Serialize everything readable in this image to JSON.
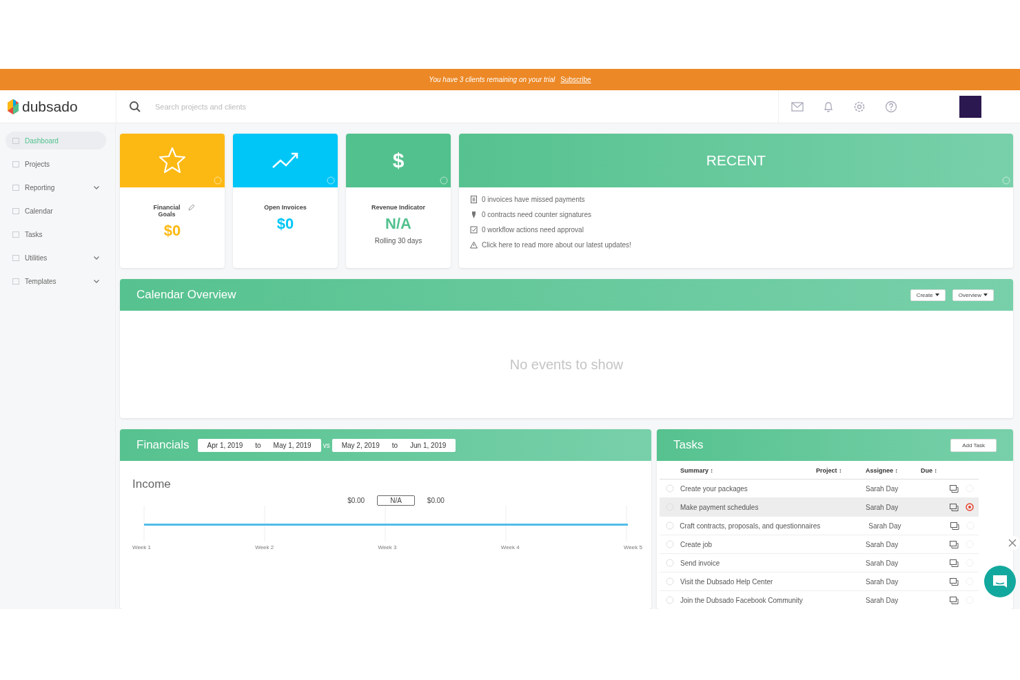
{
  "banner": {
    "text": "You have 3 clients remaining on your trial",
    "link": "Subscribe"
  },
  "header": {
    "logo": "dubsado",
    "search": {
      "placeholder": "Search projects and clients"
    }
  },
  "sidebar": {
    "items": [
      {
        "label": "Dashboard",
        "selected": true,
        "expandable": false
      },
      {
        "label": "Projects",
        "selected": false,
        "expandable": false
      },
      {
        "label": "Reporting",
        "selected": false,
        "expandable": true
      },
      {
        "label": "Calendar",
        "selected": false,
        "expandable": false
      },
      {
        "label": "Tasks",
        "selected": false,
        "expandable": false
      },
      {
        "label": "Utilities",
        "selected": false,
        "expandable": true
      },
      {
        "label": "Templates",
        "selected": false,
        "expandable": true
      }
    ]
  },
  "cards": [
    {
      "kind": "goal",
      "color": "#fdb913",
      "title": "Financial Goals",
      "value": "$0",
      "editable": true
    },
    {
      "kind": "trend",
      "color": "#00c6f7",
      "title": "Open Invoices",
      "value": "$0",
      "editable": false
    },
    {
      "kind": "dollar",
      "color": "#52c18e",
      "symbol": "$",
      "title": "Revenue Indicator",
      "value": "N/A",
      "note": "Rolling 30 days",
      "editable": false
    }
  ],
  "recent": {
    "title": "RECENT",
    "items": [
      {
        "kind": "invoice",
        "text": "0 invoices have missed payments"
      },
      {
        "kind": "contract",
        "text": "0 contracts need counter signatures"
      },
      {
        "kind": "workflow",
        "text": "0 workflow actions need approval"
      },
      {
        "kind": "alert",
        "text": "Click here to read more about our latest updates!"
      }
    ]
  },
  "calendar": {
    "title": "Calendar Overview",
    "buttons": [
      "Create",
      "Overview"
    ],
    "empty": "No events to show"
  },
  "financials": {
    "title": "Financials",
    "range_a": {
      "from": "Apr 1, 2019",
      "sep": "to",
      "to": "May 1, 2019"
    },
    "vs": "vs",
    "range_b": {
      "from": "May 2, 2019",
      "sep": "to",
      "to": "Jun 1, 2019"
    },
    "chart_title": "Income",
    "left_total": "$0.00",
    "change": "N/A",
    "right_total": "$0.00",
    "week_labels": [
      "Week 1",
      "Week 2",
      "Week 3",
      "Week 4",
      "Week 5"
    ]
  },
  "tasks": {
    "title": "Tasks",
    "add_button": "Add Task",
    "columns": [
      "Summary ↕",
      "Project ↕",
      "Assignee ↕",
      "Due ↕"
    ],
    "rows": [
      {
        "summary": "Create your packages",
        "assignee": "Sarah Day",
        "selected": false
      },
      {
        "summary": "Make payment schedules",
        "assignee": "Sarah Day",
        "selected": true
      },
      {
        "summary": "Craft contracts, proposals, and questionnaires",
        "assignee": "Sarah Day",
        "selected": false
      },
      {
        "summary": "Create job",
        "assignee": "Sarah Day",
        "selected": false
      },
      {
        "summary": "Send invoice",
        "assignee": "Sarah Day",
        "selected": false
      },
      {
        "summary": "Visit the Dubsado Help Center",
        "assignee": "Sarah Day",
        "selected": false
      },
      {
        "summary": "Join the Dubsado Facebook Community",
        "assignee": "Sarah Day",
        "selected": false
      }
    ]
  }
}
